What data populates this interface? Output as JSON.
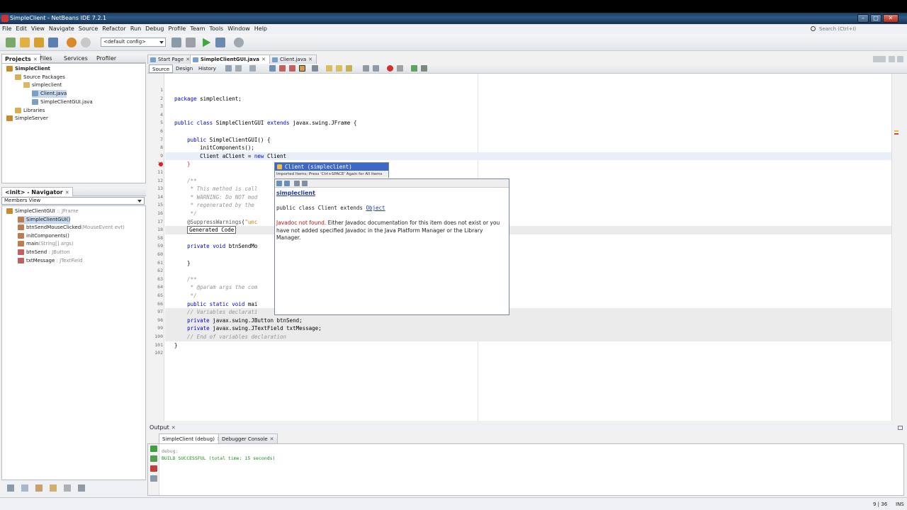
{
  "window": {
    "title": "SimpleClient - NetBeans IDE 7.2.1",
    "min": "–",
    "max": "□",
    "close": "✕"
  },
  "menu": [
    "File",
    "Edit",
    "View",
    "Navigate",
    "Source",
    "Refactor",
    "Run",
    "Debug",
    "Profile",
    "Team",
    "Tools",
    "Window",
    "Help"
  ],
  "search": {
    "placeholder": "Search (Ctrl+I)"
  },
  "toolbar": {
    "config": "<default config>"
  },
  "projects_panel": {
    "tabs": [
      "Projects",
      "Files",
      "Services",
      "Profiler"
    ],
    "tree": [
      {
        "label": "SimpleClient",
        "level": 0,
        "bold": true
      },
      {
        "label": "Source Packages",
        "level": 1
      },
      {
        "label": "simpleclient",
        "level": 2
      },
      {
        "label": "Client.java",
        "level": 3,
        "selected": true
      },
      {
        "label": "SimpleClientGUI.java",
        "level": 3
      },
      {
        "label": "Libraries",
        "level": 1
      },
      {
        "label": "SimpleServer",
        "level": 0
      }
    ]
  },
  "navigator": {
    "title": "<init> - Navigator",
    "filter": "Members View",
    "items": [
      {
        "name": "SimpleClientGUI",
        "type": " :: JFrame",
        "level": 0
      },
      {
        "name": "SimpleClientGUI()",
        "type": "",
        "level": 1,
        "selected": true
      },
      {
        "name": "btnSendMouseClicked",
        "type": "(MouseEvent evt)",
        "level": 1
      },
      {
        "name": "initComponents()",
        "type": "",
        "level": 1
      },
      {
        "name": "main",
        "type": "(String[] args)",
        "level": 1
      },
      {
        "name": "btnSend",
        "type": " : JButton",
        "level": 1
      },
      {
        "name": "txtMessage",
        "type": " : JTextField",
        "level": 1
      }
    ]
  },
  "editor": {
    "tabs": [
      "Start Page",
      "SimpleClientGUI.java",
      "Client.java"
    ],
    "modes": [
      "Source",
      "Design",
      "History"
    ],
    "lines": [
      {
        "n": "1",
        "text": ""
      },
      {
        "n": "2",
        "text": "package simpleclient;"
      },
      {
        "n": "3",
        "text": ""
      },
      {
        "n": "4",
        "text": ""
      },
      {
        "n": "5",
        "text": "public class SimpleClientGUI extends javax.swing.JFrame {"
      },
      {
        "n": "6",
        "text": ""
      },
      {
        "n": "7",
        "text": "    public SimpleClientGUI() {"
      },
      {
        "n": "8",
        "text": "        initComponents();"
      },
      {
        "n": "9",
        "text": "        Client aClient = new Client"
      },
      {
        "n": "10",
        "text": "    }"
      },
      {
        "n": "11",
        "text": ""
      },
      {
        "n": "12",
        "text": "    /**"
      },
      {
        "n": "13",
        "text": "     * This method is call"
      },
      {
        "n": "14",
        "text": "     * WARNING: Do NOT mod"
      },
      {
        "n": "15",
        "text": "     * regenerated by the"
      },
      {
        "n": "16",
        "text": "     */"
      },
      {
        "n": "17",
        "text": "    @SuppressWarnings(\"unc"
      },
      {
        "n": "18",
        "text": "    Generated Code"
      },
      {
        "n": "58",
        "text": ""
      },
      {
        "n": "59",
        "text": "    private void btnSendMo"
      },
      {
        "n": "60",
        "text": ""
      },
      {
        "n": "61",
        "text": "    }"
      },
      {
        "n": "62",
        "text": ""
      },
      {
        "n": "63",
        "text": "    /**"
      },
      {
        "n": "64",
        "text": "     * @param args the com"
      },
      {
        "n": "65",
        "text": "     */"
      },
      {
        "n": "66",
        "text": "    public static void mai"
      },
      {
        "n": "97",
        "text": "    // Variables declarati"
      },
      {
        "n": "98",
        "text": "    private javax.swing.JButton btnSend;"
      },
      {
        "n": "99",
        "text": "    private javax.swing.JTextField txtMessage;"
      },
      {
        "n": "100",
        "text": "    // End of variables declaration"
      },
      {
        "n": "101",
        "text": "}"
      },
      {
        "n": "102",
        "text": ""
      }
    ]
  },
  "completion": {
    "item": "Client (simpleclient)",
    "hint": "Imported Items; Press 'Ctrl+SPACE' Again for All Items"
  },
  "javadoc": {
    "package": "simpleclient",
    "sig_prefix": "public class Client extends ",
    "sig_link": "Object",
    "msg_red": "Javadoc not found.",
    "msg": " Either Javadoc documentation for this item does not exist or you have not added specified Javadoc in the Java Platform Manager or the Library Manager."
  },
  "output": {
    "title": "Output",
    "tabs": [
      "SimpleClient (debug)",
      "Debugger Console"
    ],
    "lines": [
      "debug:",
      "BUILD SUCCESSFUL (total time: 15 seconds)"
    ]
  },
  "status": {
    "position": "9 | 36",
    "mode": "INS"
  }
}
